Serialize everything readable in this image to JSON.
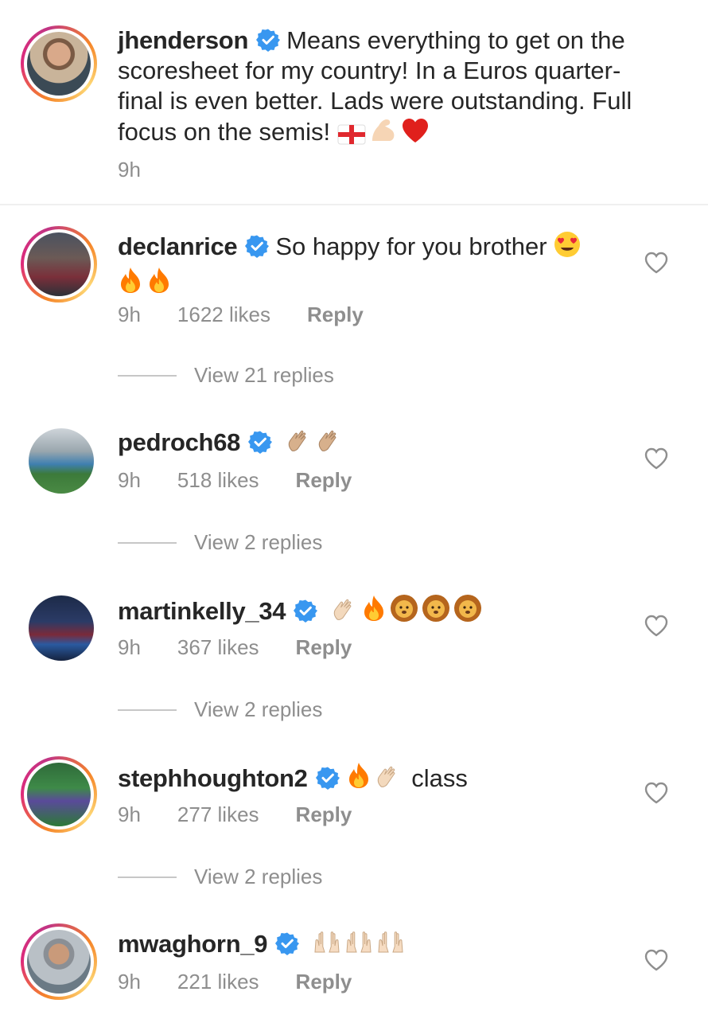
{
  "caption": {
    "username": "jhenderson",
    "text": "Means everything to get on the scoresheet for my country! In a Euros quarter-final is even better. Lads were outstanding. Full focus on the semis!",
    "emojis": [
      "flag-england",
      "flexed-biceps",
      "red-heart"
    ],
    "time": "9h"
  },
  "comments": [
    {
      "username": "declanrice",
      "text": "So happy for you brother",
      "emojis": [
        "heart-eyes",
        "fire",
        "fire"
      ],
      "time": "9h",
      "likes": "1622 likes",
      "reply_label": "Reply",
      "view_replies": "View 21 replies",
      "story_ring": true
    },
    {
      "username": "pedroch68",
      "text": "",
      "emojis": [
        "clapping-hands",
        "clapping-hands"
      ],
      "time": "9h",
      "likes": "518 likes",
      "reply_label": "Reply",
      "view_replies": "View 2 replies",
      "story_ring": false
    },
    {
      "username": "martinkelly_34",
      "text": "",
      "emojis": [
        "clapping-hands",
        "fire",
        "lion",
        "lion",
        "lion"
      ],
      "time": "9h",
      "likes": "367 likes",
      "reply_label": "Reply",
      "view_replies": "View 2 replies",
      "story_ring": false
    },
    {
      "username": "stephhoughton2",
      "text": "class",
      "emojis": [
        "fire",
        "clapping-hands"
      ],
      "time": "9h",
      "likes": "277 likes",
      "reply_label": "Reply",
      "view_replies": "View 2 replies",
      "story_ring": true
    },
    {
      "username": "mwaghorn_9",
      "text": "",
      "emojis": [
        "raising-hands",
        "raising-hands",
        "raising-hands"
      ],
      "time": "9h",
      "likes": "221 likes",
      "reply_label": "Reply",
      "story_ring": true
    }
  ],
  "colors": {
    "verified_blue": "#3897f0",
    "secondary_text": "#8e8e8e",
    "primary_text": "#262626"
  }
}
